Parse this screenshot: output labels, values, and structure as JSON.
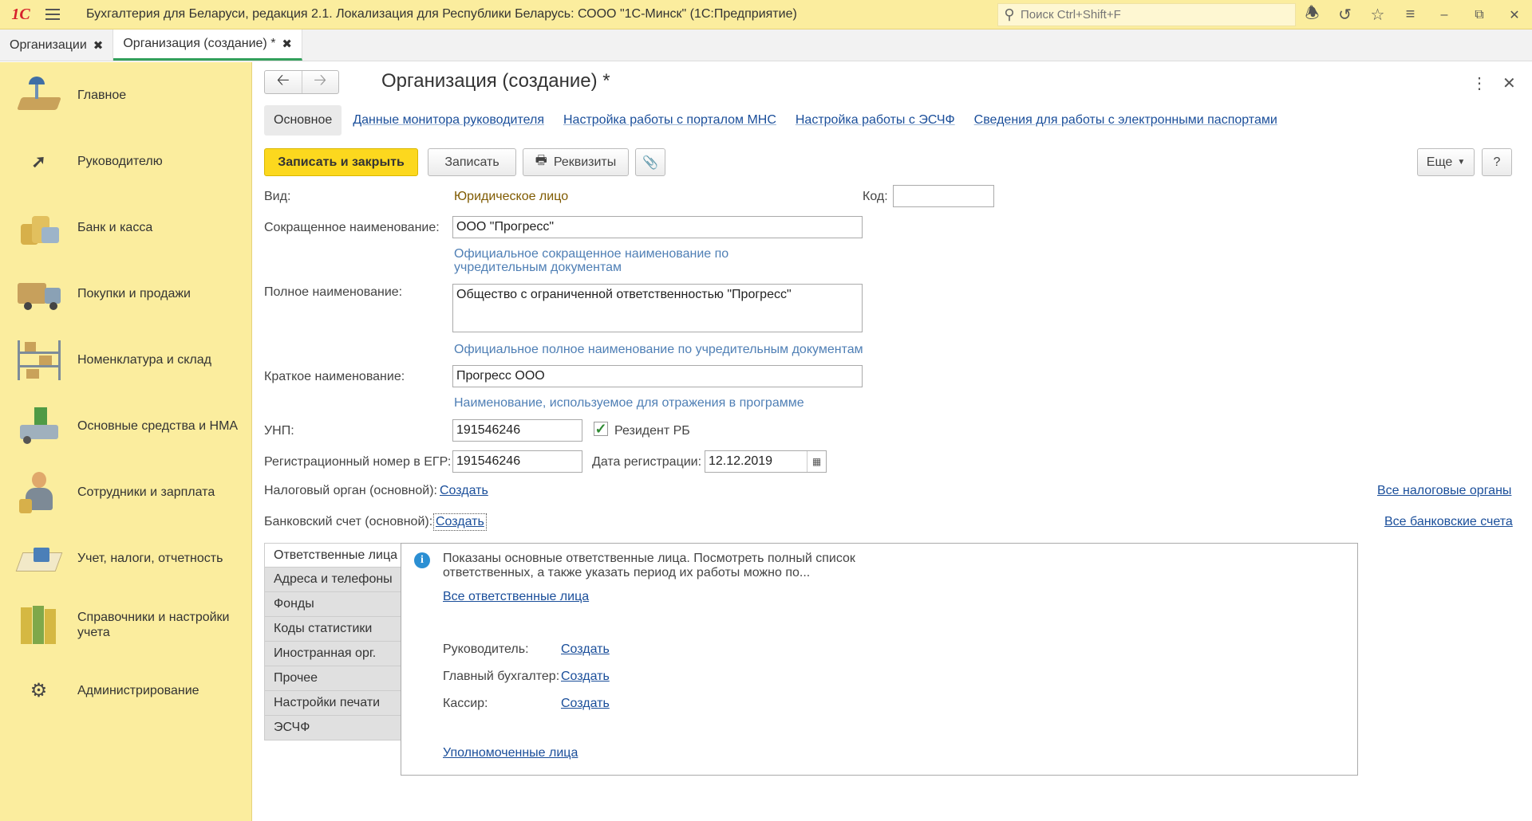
{
  "titlebar": {
    "logo": "1С",
    "title": "Бухгалтерия для Беларуси, редакция 2.1. Локализация для Республики Беларусь: СООО \"1С-Минск\"  (1С:Предприятие)",
    "search_placeholder": "Поиск Ctrl+Shift+F"
  },
  "tabs": [
    {
      "label": "Организации"
    },
    {
      "label": "Организация (создание) *"
    }
  ],
  "sidebar": {
    "items": [
      {
        "label": "Главное",
        "icon": "desk-lamp-icon"
      },
      {
        "label": "Руководителю",
        "icon": "trend-chart-icon"
      },
      {
        "label": "Банк и касса",
        "icon": "coins-icon"
      },
      {
        "label": "Покупки и продажи",
        "icon": "truck-icon"
      },
      {
        "label": "Номенклатура и склад",
        "icon": "warehouse-shelves-icon"
      },
      {
        "label": "Основные средства и НМА",
        "icon": "machine-icon"
      },
      {
        "label": "Сотрудники и зарплата",
        "icon": "employee-icon"
      },
      {
        "label": "Учет, налоги, отчетность",
        "icon": "calculator-icon"
      },
      {
        "label": "Справочники и настройки учета",
        "icon": "binders-icon"
      },
      {
        "label": "Администрирование",
        "icon": "gear-icon"
      }
    ]
  },
  "form": {
    "title": "Организация (создание) *",
    "subnav": [
      "Основное",
      "Данные монитора руководителя",
      "Настройка работы с порталом МНС",
      "Настройка работы с ЭСЧФ",
      "Сведения для работы с электронными паспортами"
    ],
    "buttons": {
      "save_close": "Записать и закрыть",
      "save": "Записать",
      "details": "Реквизиты",
      "more": "Еще",
      "help": "?"
    },
    "fields": {
      "kind_label": "Вид:",
      "kind_value": "Юридическое лицо",
      "code_label": "Код:",
      "code_value": "",
      "short_name_label": "Сокращенное наименование:",
      "short_name_value": "ООО \"Прогресс\"",
      "short_name_hint": "Официальное сокращенное наименование по учредительным документам",
      "full_name_label": "Полное наименование:",
      "full_name_value": "Общество с ограниченной ответственностью \"Прогресс\"",
      "full_name_hint": "Официальное полное наименование по учредительным документам",
      "brief_name_label": "Краткое наименование:",
      "brief_name_value": "Прогресс ООО",
      "brief_name_hint": "Наименование, используемое для отражения в программе",
      "unp_label": "УНП:",
      "unp_value": "191546246",
      "resident_label": "Резидент РБ",
      "reg_number_label": "Регистрационный номер в ЕГР:",
      "reg_number_value": "191546246",
      "reg_date_label": "Дата регистрации:",
      "reg_date_value": "12.12.2019",
      "tax_label": "Налоговый орган (основной):",
      "tax_link": "Создать",
      "tax_all": "Все налоговые органы",
      "bank_label": "Банковский счет (основной):",
      "bank_link": "Создать",
      "bank_all": "Все банковские счета"
    },
    "vtabs": [
      "Ответственные лица",
      "Адреса и телефоны",
      "Фонды",
      "Коды статистики",
      "Иностранная орг.",
      "Прочее",
      "Настройки печати",
      "ЭСЧФ"
    ],
    "panel": {
      "info": "Показаны основные ответственные лица. Посмотреть полный список ответственных, а также указать период их работы можно по...",
      "all_link": "Все ответственные лица",
      "director_label": "Руководитель:",
      "accountant_label": "Главный бухгалтер:",
      "cashier_label": "Кассир:",
      "create": "Создать",
      "authorized_link": "Уполномоченные лица"
    }
  }
}
